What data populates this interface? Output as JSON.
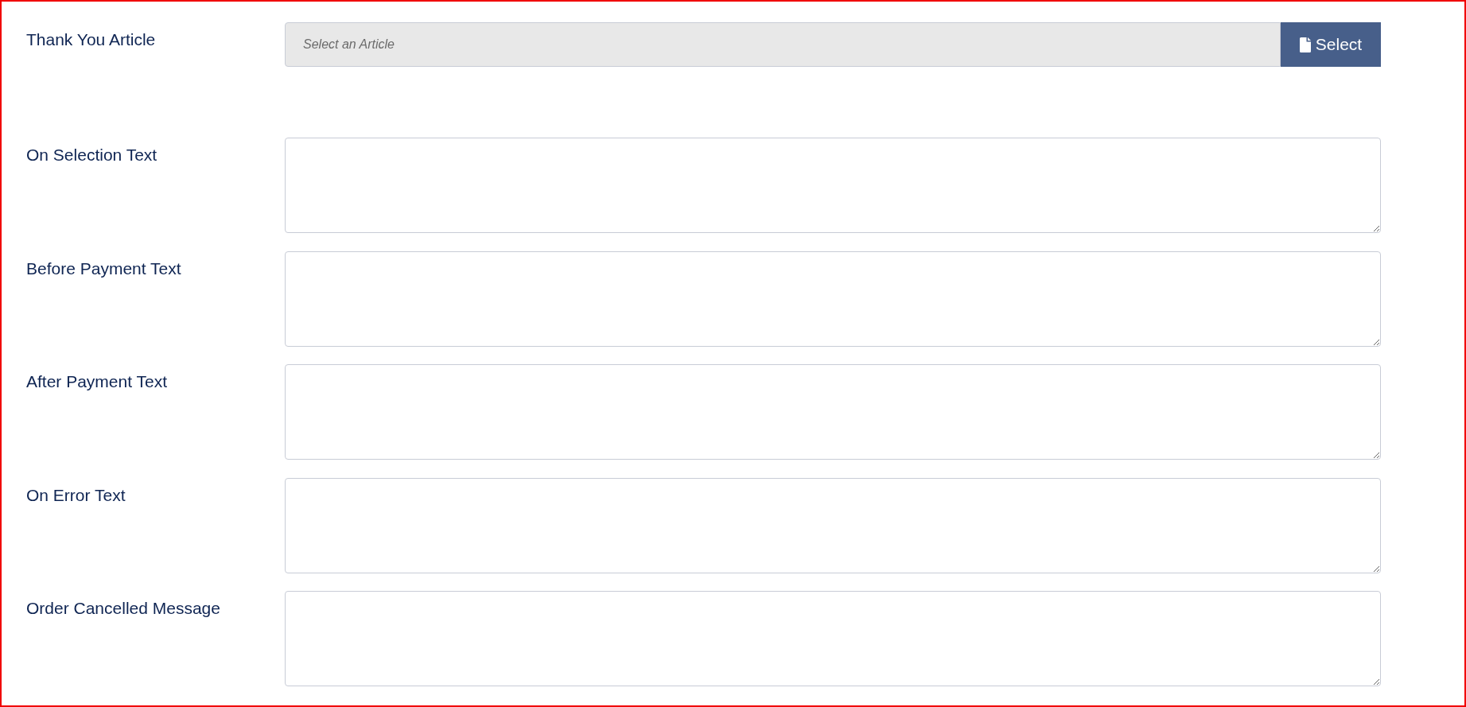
{
  "article_field": {
    "label": "Thank You Article",
    "placeholder": "Select an Article",
    "button": "Select"
  },
  "text_fields": [
    {
      "label": "On Selection Text"
    },
    {
      "label": "Before Payment Text"
    },
    {
      "label": "After Payment Text"
    },
    {
      "label": "On Error Text"
    },
    {
      "label": "Order Cancelled Message"
    }
  ]
}
